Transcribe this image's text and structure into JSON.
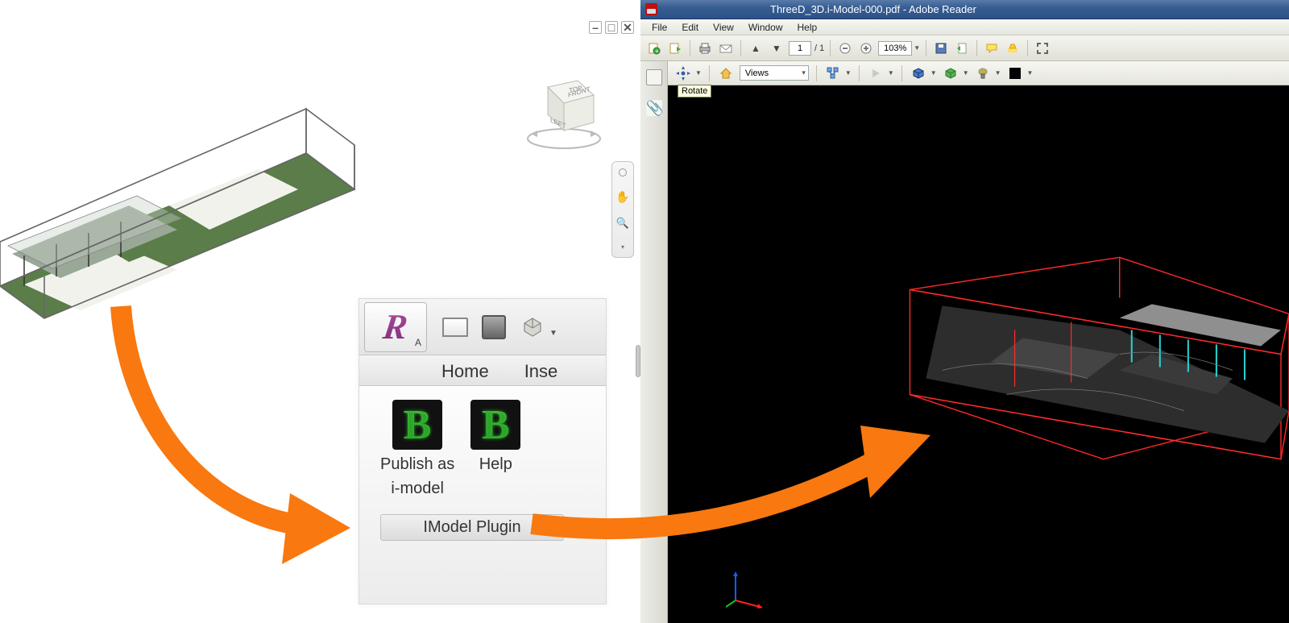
{
  "revit_window": {
    "viewcube_faces": {
      "top": "TOP",
      "left": "LEFT",
      "front": "FRONT"
    }
  },
  "ribbon": {
    "app_button_sub": "A",
    "tabs": {
      "home": "Home",
      "insert": "Inse"
    },
    "panel": {
      "publish_label_line1": "Publish as",
      "publish_label_line2": "i-model",
      "help_label": "Help",
      "title": "IModel Plugin"
    }
  },
  "reader": {
    "title": "ThreeD_3D.i-Model-000.pdf - Adobe Reader",
    "menu": [
      "File",
      "Edit",
      "View",
      "Window",
      "Help"
    ],
    "page_current": "1",
    "page_total": "/ 1",
    "zoom": "103%",
    "views_label": "Views",
    "tooltip": "Rotate"
  }
}
